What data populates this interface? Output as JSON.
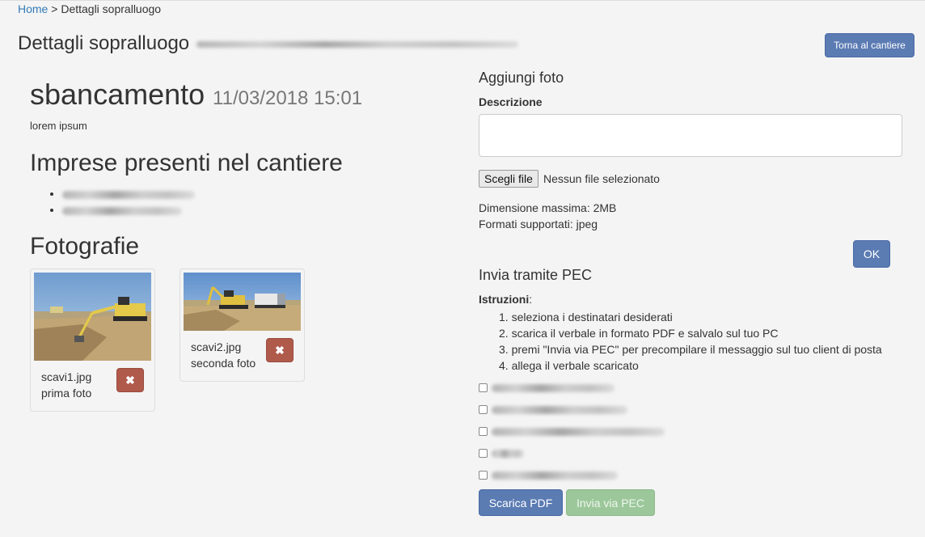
{
  "breadcrumb": {
    "home": "Home",
    "separator": ">",
    "current": "Dettagli sopralluogo"
  },
  "page": {
    "title": "Dettagli sopralluogo",
    "back_button": "Torna al cantiere"
  },
  "inspection": {
    "name": "sbancamento",
    "datetime": "11/03/2018 15:01",
    "description": "lorem ipsum"
  },
  "companies": {
    "heading": "Imprese presenti nel cantiere"
  },
  "photos": {
    "heading": "Fotografie",
    "items": [
      {
        "filename": "scavi1.jpg",
        "caption": "prima foto",
        "delete_icon": "✖"
      },
      {
        "filename": "scavi2.jpg",
        "caption": "seconda foto",
        "delete_icon": "✖"
      }
    ]
  },
  "add_photo": {
    "heading": "Aggiungi foto",
    "description_label": "Descrizione",
    "description_value": "",
    "file_button": "Scegli file",
    "file_status": "Nessun file selezionato",
    "max_size": "Dimensione massima: 2MB",
    "formats": "Formati supportati: jpeg",
    "ok_button": "OK"
  },
  "pec": {
    "heading": "Invia tramite PEC",
    "instructions_label": "Istruzioni",
    "instructions_colon": ":",
    "steps": [
      "1. seleziona i destinatari desiderati",
      "2. scarica il verbale in formato PDF e salvalo sul tuo PC",
      "3. premi \"Invia via PEC\" per precompilare il messaggio sul tuo client di posta",
      "4. allega il verbale scaricato"
    ],
    "download_button": "Scarica PDF",
    "send_button": "Invia via PEC"
  },
  "colors": {
    "primary": "#5b7bb3",
    "danger": "#b05a4c",
    "success_disabled": "#9cc79a",
    "link": "#337ab7"
  }
}
